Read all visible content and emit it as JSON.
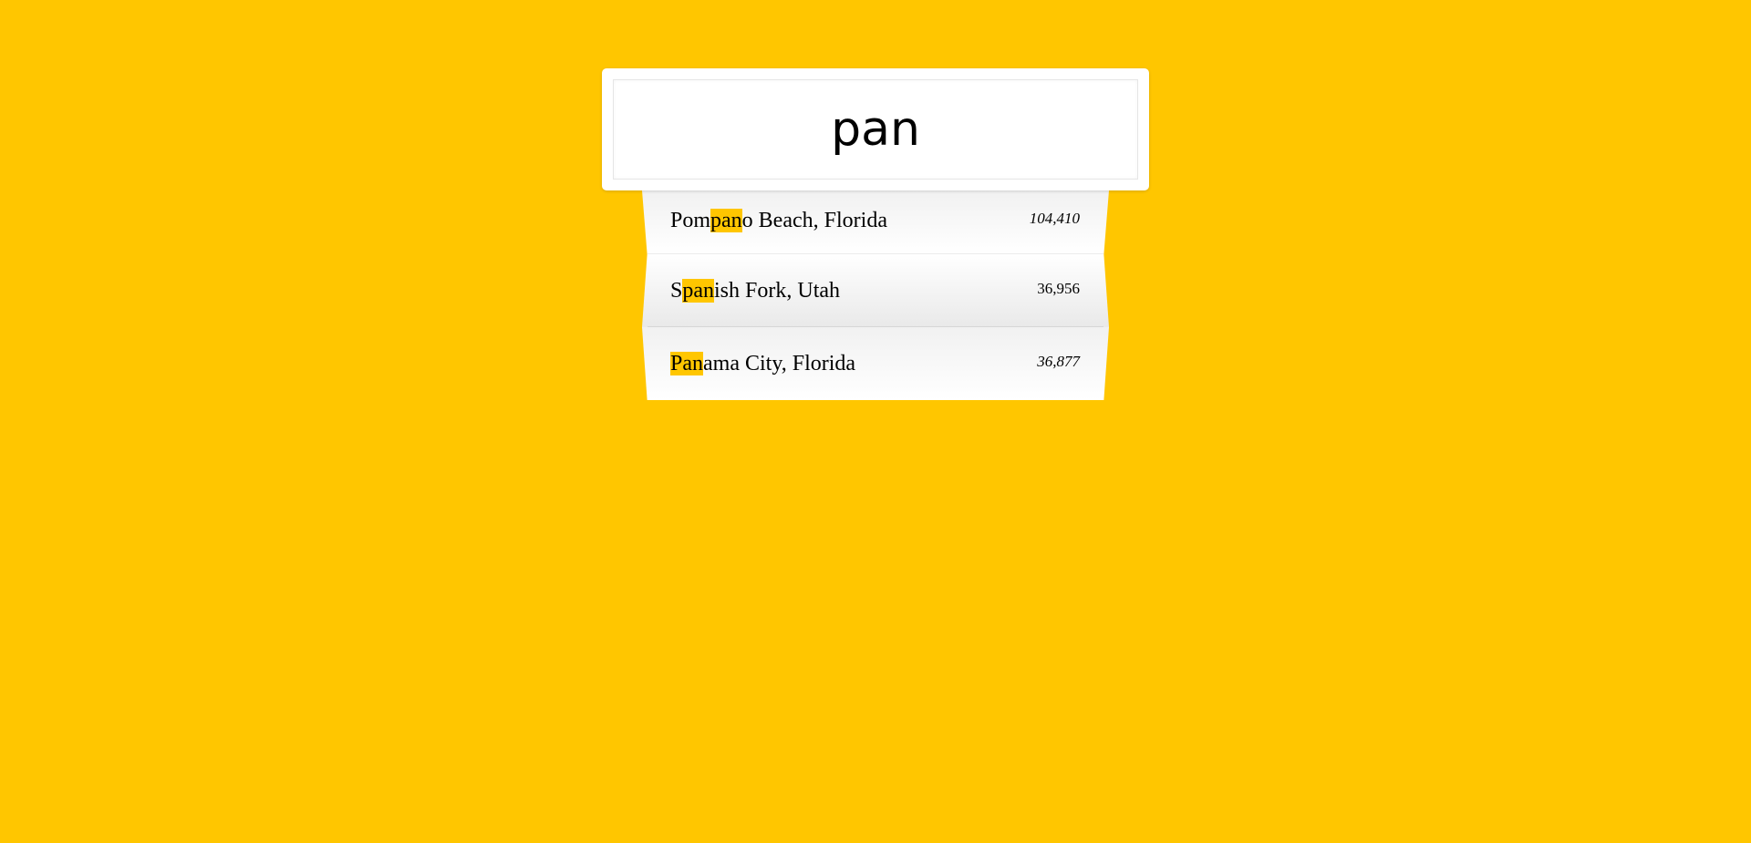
{
  "page": {
    "background_color": "#FFC600",
    "highlight_color": "#FFC600"
  },
  "search": {
    "value": "pan",
    "placeholder": ""
  },
  "suggestions": [
    {
      "name_before": "Pom",
      "name_match": "pan",
      "name_after": "o Beach, Florida",
      "population": "104,410"
    },
    {
      "name_before": "S",
      "name_match": "pan",
      "name_after": "ish Fork, Utah",
      "population": "36,956"
    },
    {
      "name_before": "",
      "name_match": "Pan",
      "name_after": "ama City, Florida",
      "population": "36,877"
    }
  ]
}
